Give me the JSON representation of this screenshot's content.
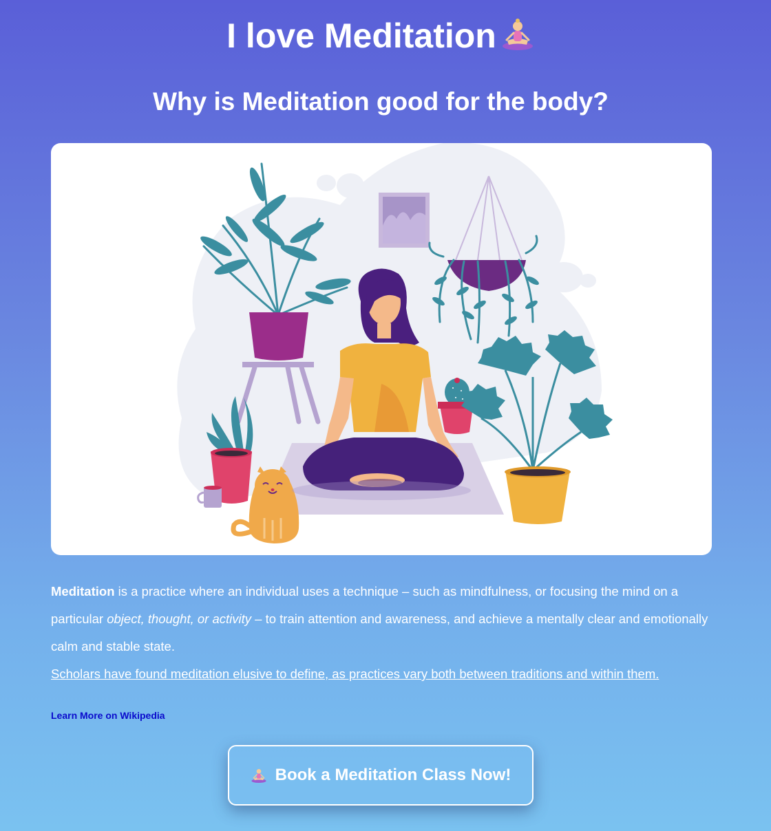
{
  "header": {
    "title": "I love Meditation",
    "title_emoji": "person-in-lotus-position-icon",
    "subtitle": "Why is Meditation good for the body?"
  },
  "hero": {
    "image": "meditation-illustration"
  },
  "content": {
    "term": "Meditation",
    "text_1": " is a practice where an individual uses a technique – such as mindfulness, or focusing the mind on a particular ",
    "italic": "object, thought, or activity",
    "text_2": " – to train attention and awareness, and achieve a mentally clear and emotionally calm and stable state.",
    "scholars": "Scholars have found meditation elusive to define, as practices vary both between traditions and within them.",
    "wiki_link": "Learn More on Wikipedia"
  },
  "cta": {
    "label": "Book a Meditation Class Now!",
    "emoji": "person-in-lotus-position-icon"
  },
  "colors": {
    "gradient_top": "#5a5fd8",
    "gradient_bottom": "#7ac2f0",
    "link": "#0a0acc",
    "card": "#ffffff"
  }
}
